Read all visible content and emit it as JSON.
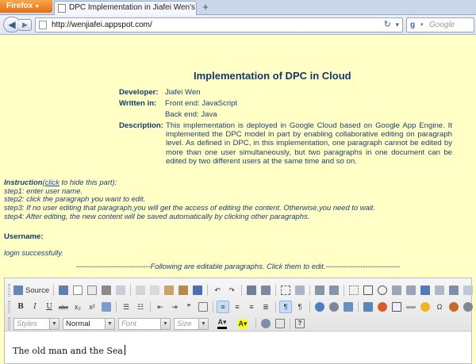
{
  "browser": {
    "app_menu": "Firefox",
    "tab_title": "DPC Implementation in Jiafei Wen's ...",
    "url": "http://wenjiafei.appspot.com/",
    "search_placeholder": "Google"
  },
  "page": {
    "title": "Implementation of DPC in Cloud",
    "info": {
      "developer_label": "Developer:",
      "developer": "Jiafei Wen",
      "written_label": "Written in:",
      "frontend": "Front end: JavaScript",
      "backend": "Back end: Java",
      "description_label": "Description:",
      "description": "This implementation is deployed in Google Cloud based on Google App Engine. It implemented the DPC model in part by enabling collaborative editing on paragraph level. As defined in DPC, in this implementation, one paragraph cannot be edited by more than one user simultaneously, but two paragraphs in one document can be edited by two different users at the same time and so on."
    },
    "instruction": {
      "label": "Instruction",
      "open_paren": "(",
      "link": "click",
      "link_suffix": " to hide this part):",
      "steps": [
        "step1: enter user name.",
        "step2: click the paragraph you want to edit.",
        "step3: If no user editing that paragraph,you will get the access of editing the content. Otherwise,you need to wait.",
        "step4: After editing, the new content will be saved automatically by clicking other paragraphs."
      ]
    },
    "username_label": "Username:",
    "login_message": "login successfully.",
    "separator": "------------------------------Following are editable paragraphs. Click them to edit.------------------------------"
  },
  "editor": {
    "source_label": "Source",
    "styles_label": "Styles",
    "format_value": "Normal",
    "font_label": "Font",
    "size_label": "Size",
    "bold_glyph": "B",
    "italic_glyph": "I",
    "underline_glyph": "U",
    "strike_glyph": "abc",
    "content": "The old man and the Sea"
  }
}
